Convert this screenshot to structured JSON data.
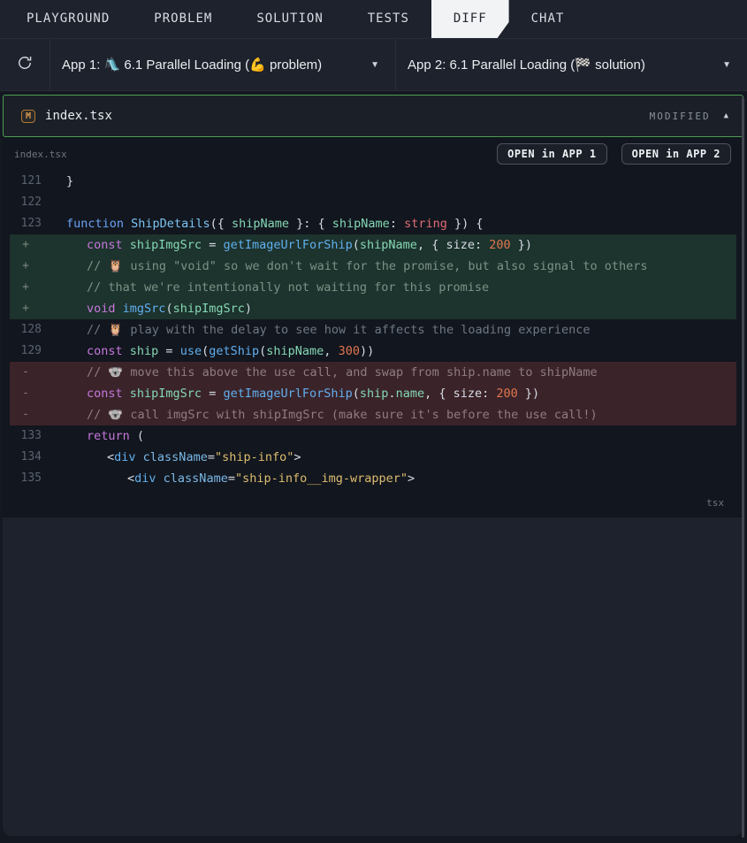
{
  "topnav": {
    "tabs": [
      {
        "label": "PLAYGROUND",
        "active": false
      },
      {
        "label": "PROBLEM",
        "active": false
      },
      {
        "label": "SOLUTION",
        "active": false
      },
      {
        "label": "TESTS",
        "active": false
      },
      {
        "label": "DIFF",
        "active": true
      },
      {
        "label": "CHAT",
        "active": false
      }
    ]
  },
  "app_selector": {
    "app1_label": "App 1: 🛝 6.1 Parallel Loading (💪 problem)",
    "app2_label": "App 2: 6.1 Parallel Loading (🏁 solution)",
    "dropdown_icon": "▼"
  },
  "file_header": {
    "badge": "M",
    "filename": "index.tsx",
    "status": "MODIFIED",
    "collapse_icon": "▲"
  },
  "diff_panel": {
    "file_label": "index.tsx",
    "open_app1_button": "OPEN in APP 1",
    "open_app2_button": "OPEN in APP 2",
    "language_label": "tsx",
    "lines": [
      {
        "gutter": "121",
        "type": "normal",
        "tokens": [
          [
            "plain",
            "}"
          ]
        ]
      },
      {
        "gutter": "122",
        "type": "normal",
        "tokens": []
      },
      {
        "gutter": "123",
        "type": "normal",
        "tokens": [
          [
            "kwb",
            "function"
          ],
          [
            "plain",
            " "
          ],
          [
            "fname",
            "ShipDetails"
          ],
          [
            "plain",
            "({ "
          ],
          [
            "var",
            "shipName"
          ],
          [
            "plain",
            " }: { "
          ],
          [
            "var",
            "shipName"
          ],
          [
            "plain",
            ": "
          ],
          [
            "type",
            "string"
          ],
          [
            "plain",
            " }) {"
          ]
        ]
      },
      {
        "gutter": "+",
        "type": "added",
        "tokens": [
          [
            "plain",
            "\t"
          ],
          [
            "kw",
            "const"
          ],
          [
            "plain",
            " "
          ],
          [
            "var",
            "shipImgSrc"
          ],
          [
            "plain",
            " = "
          ],
          [
            "fn",
            "getImageUrlForShip"
          ],
          [
            "plain",
            "("
          ],
          [
            "var",
            "shipName"
          ],
          [
            "plain",
            ", { size: "
          ],
          [
            "num",
            "200"
          ],
          [
            "plain",
            " })"
          ]
        ]
      },
      {
        "gutter": "+",
        "type": "added",
        "tokens": [
          [
            "plain",
            "\t"
          ],
          [
            "cmt",
            "// 🦉 using \"void\" so we don't wait for the promise, but also signal to others"
          ]
        ]
      },
      {
        "gutter": "+",
        "type": "added",
        "tokens": [
          [
            "plain",
            "\t"
          ],
          [
            "cmt",
            "// that we're intentionally not waiting for this promise"
          ]
        ]
      },
      {
        "gutter": "+",
        "type": "added",
        "tokens": [
          [
            "plain",
            "\t"
          ],
          [
            "kw",
            "void"
          ],
          [
            "plain",
            " "
          ],
          [
            "fn",
            "imgSrc"
          ],
          [
            "plain",
            "("
          ],
          [
            "var",
            "shipImgSrc"
          ],
          [
            "plain",
            ")"
          ]
        ]
      },
      {
        "gutter": "128",
        "type": "normal",
        "tokens": [
          [
            "plain",
            "\t"
          ],
          [
            "cmt",
            "// 🦉 play with the delay to see how it affects the loading experience"
          ]
        ]
      },
      {
        "gutter": "129",
        "type": "normal",
        "tokens": [
          [
            "plain",
            "\t"
          ],
          [
            "kw",
            "const"
          ],
          [
            "plain",
            " "
          ],
          [
            "var",
            "ship"
          ],
          [
            "plain",
            " = "
          ],
          [
            "fn",
            "use"
          ],
          [
            "plain",
            "("
          ],
          [
            "fn",
            "getShip"
          ],
          [
            "plain",
            "("
          ],
          [
            "var",
            "shipName"
          ],
          [
            "plain",
            ", "
          ],
          [
            "num",
            "300"
          ],
          [
            "plain",
            "))"
          ]
        ]
      },
      {
        "gutter": "-",
        "type": "removed",
        "tokens": [
          [
            "plain",
            "\t"
          ],
          [
            "cmt",
            "// 🐨 move this above the use call, and swap from ship.name to shipName"
          ]
        ]
      },
      {
        "gutter": "-",
        "type": "removed",
        "tokens": [
          [
            "plain",
            "\t"
          ],
          [
            "kw",
            "const"
          ],
          [
            "plain",
            " "
          ],
          [
            "var",
            "shipImgSrc"
          ],
          [
            "plain",
            " = "
          ],
          [
            "fn",
            "getImageUrlForShip"
          ],
          [
            "plain",
            "("
          ],
          [
            "var",
            "ship"
          ],
          [
            "plain",
            "."
          ],
          [
            "var",
            "name"
          ],
          [
            "plain",
            ", { size: "
          ],
          [
            "num",
            "200"
          ],
          [
            "plain",
            " })"
          ]
        ]
      },
      {
        "gutter": "-",
        "type": "removed",
        "tokens": [
          [
            "plain",
            "\t"
          ],
          [
            "cmt",
            "// 🐨 call imgSrc with shipImgSrc (make sure it's before the use call!)"
          ]
        ]
      },
      {
        "gutter": "133",
        "type": "normal",
        "tokens": [
          [
            "plain",
            "\t"
          ],
          [
            "kw",
            "return"
          ],
          [
            "plain",
            " ("
          ]
        ]
      },
      {
        "gutter": "134",
        "type": "normal",
        "tokens": [
          [
            "plain",
            "\t\t<"
          ],
          [
            "tag",
            "div"
          ],
          [
            "plain",
            " "
          ],
          [
            "attr",
            "className"
          ],
          [
            "plain",
            "="
          ],
          [
            "str",
            "\"ship-info\""
          ],
          [
            "plain",
            ">"
          ]
        ]
      },
      {
        "gutter": "135",
        "type": "normal",
        "tokens": [
          [
            "plain",
            "\t\t\t<"
          ],
          [
            "tag",
            "div"
          ],
          [
            "plain",
            " "
          ],
          [
            "attr",
            "className"
          ],
          [
            "plain",
            "="
          ],
          [
            "str",
            "\"ship-info__img-wrapper\""
          ],
          [
            "plain",
            ">"
          ]
        ]
      }
    ]
  },
  "colors": {
    "accent_green": "#4e9b52",
    "modified_orange": "#d99a4e",
    "added_line_bg": "#1d332d",
    "removed_line_bg": "#3a2329",
    "active_tab_bg": "#f2f3f5"
  }
}
